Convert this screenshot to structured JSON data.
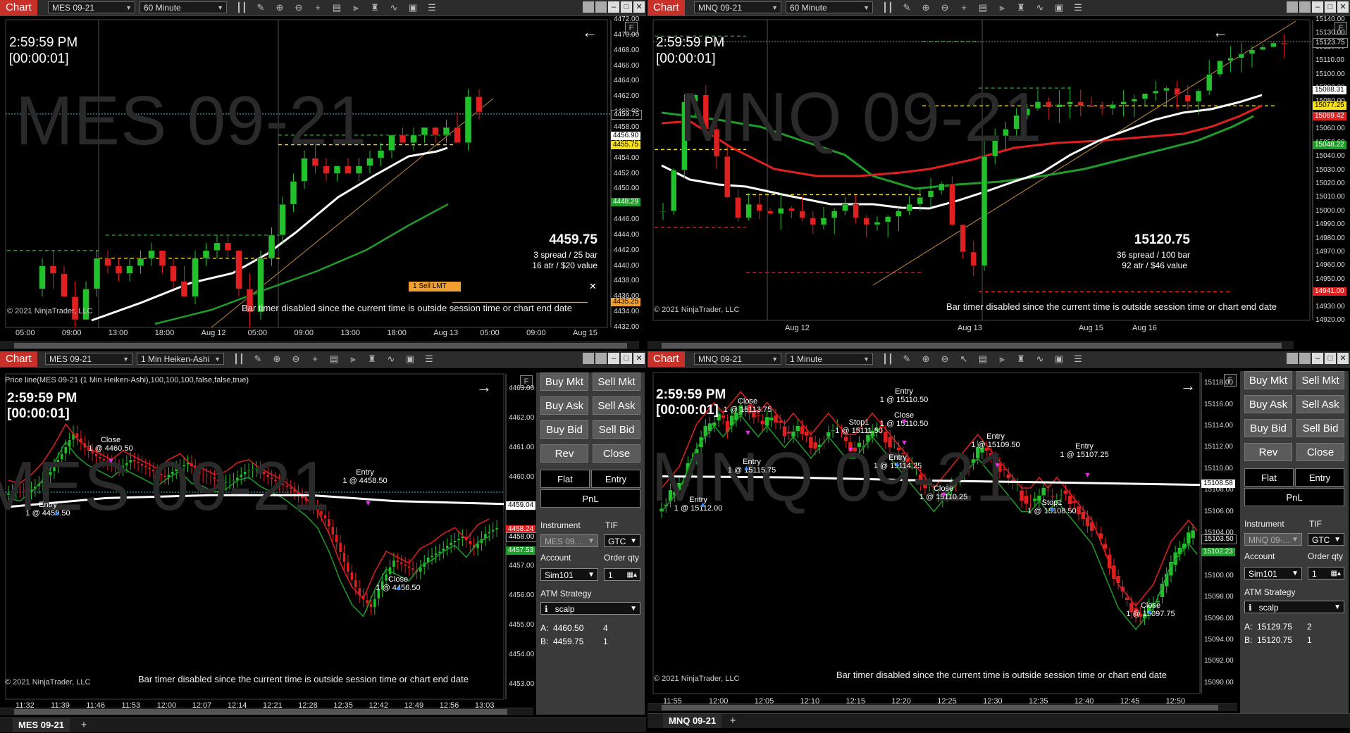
{
  "panels": {
    "p1": {
      "title": "Chart",
      "instrument": "MES 09-21",
      "interval": "60 Minute",
      "clock": "2:59:59 PM",
      "countdown": "[00:00:01]",
      "watermark": "MES 09-21",
      "big_price": "4459.75",
      "info1": "3 spread / 25 bar",
      "info2": "16 atr / $20 value",
      "copyright": "© 2021 NinjaTrader, LLC",
      "bar_timer": "Bar timer disabled since the current time is outside session time or chart end date",
      "order_label": "1 Sell LMT",
      "order_close": "✕",
      "y_ticks": [
        "4472.00",
        "4470.00",
        "4468.00",
        "4466.00",
        "4464.00",
        "4462.00",
        "4460.00",
        "4458.00",
        "4456.00",
        "4454.00",
        "4452.00",
        "4450.00",
        "4448.00",
        "4446.00",
        "4444.00",
        "4442.00",
        "4440.00",
        "4438.00",
        "4436.00",
        "4434.00",
        "4432.00"
      ],
      "x_ticks": [
        "05:00",
        "09:00",
        "13:00",
        "18:00",
        "Aug 12",
        "05:00",
        "09:00",
        "13:00",
        "18:00",
        "Aug 13",
        "05:00",
        "09:00",
        "Aug 15"
      ],
      "price_tags": [
        {
          "text": "4459.75",
          "color": "#000000",
          "text_color": "#ffffff"
        },
        {
          "text": "4456.90",
          "color": "#ffffff",
          "text_color": "#000000"
        },
        {
          "text": "4455.75",
          "color": "#f5e020",
          "text_color": "#000000"
        },
        {
          "text": "4448.29",
          "color": "#1f9c2a",
          "text_color": "#ffffff"
        },
        {
          "text": "4435.25",
          "color": "#f0a030",
          "text_color": "#000000"
        }
      ]
    },
    "p2": {
      "title": "Chart",
      "instrument": "MNQ 09-21",
      "interval": "60 Minute",
      "clock": "2:59:59 PM",
      "countdown": "[00:00:01]",
      "watermark": "MNQ 09-21",
      "big_price": "15120.75",
      "info1": "36 spread / 100 bar",
      "info2": "92 atr / $46 value",
      "copyright": "© 2021 NinjaTrader, LLC",
      "bar_timer": "Bar timer disabled since the current time is outside session time or chart end date",
      "y_ticks": [
        "15140.00",
        "15130.00",
        "15120.00",
        "15110.00",
        "15100.00",
        "15090.00",
        "15080.00",
        "15070.00",
        "15060.00",
        "15050.00",
        "15040.00",
        "15030.00",
        "15020.00",
        "15010.00",
        "15000.00",
        "14990.00",
        "14980.00",
        "14970.00",
        "14960.00",
        "14950.00",
        "14940.00",
        "14930.00",
        "14920.00"
      ],
      "x_ticks": [
        "Aug 12",
        "Aug 13",
        "Aug 15",
        "Aug 16"
      ],
      "price_tags": [
        {
          "text": "15123.75",
          "color": "#000000",
          "text_color": "#ffffff"
        },
        {
          "text": "15088.31",
          "color": "#ffffff",
          "text_color": "#000000"
        },
        {
          "text": "15077.25",
          "color": "#f5e020",
          "text_color": "#000000"
        },
        {
          "text": "15069.42",
          "color": "#e02020",
          "text_color": "#ffffff"
        },
        {
          "text": "15048.22",
          "color": "#1f9c2a",
          "text_color": "#ffffff"
        },
        {
          "text": "14941.00",
          "color": "#e02020",
          "text_color": "#ffffff"
        }
      ]
    },
    "p3": {
      "title": "Chart",
      "instrument": "MES 09-21",
      "interval": "1 Min Heiken-Ashi",
      "indicator": "Price line(MES 09-21 (1 Min Heiken-Ashi),100,100,100,false,false,true)",
      "clock": "2:59:59 PM",
      "countdown": "[00:00:01]",
      "watermark": "MES 09-21",
      "copyright": "© 2021 NinjaTrader, LLC",
      "bar_timer": "Bar timer disabled since the current time is outside session time or chart end date",
      "y_ticks": [
        "4463.00",
        "4462.00",
        "4461.00",
        "4460.00",
        "4459.00",
        "4458.00",
        "4457.00",
        "4456.00",
        "4455.00",
        "4454.00",
        "4453.00"
      ],
      "x_ticks": [
        "11:32",
        "11:39",
        "11:46",
        "11:53",
        "12:00",
        "12:07",
        "12:14",
        "12:21",
        "12:28",
        "12:35",
        "12:42",
        "12:49",
        "12:56",
        "13:03"
      ],
      "price_tags": [
        {
          "text": "4459.04",
          "color": "#ffffff",
          "text_color": "#000000"
        },
        {
          "text": "4458.24",
          "color": "#e02020",
          "text_color": "#ffffff"
        },
        {
          "text": "4458.00",
          "color": "#000000",
          "text_color": "#ffffff"
        },
        {
          "text": "4457.53",
          "color": "#1f9c2a",
          "text_color": "#ffffff"
        }
      ],
      "annotations": [
        {
          "l1": "Close",
          "l2": "1 @ 4460.50"
        },
        {
          "l1": "Entry",
          "l2": "1 @ 4459.50"
        },
        {
          "l1": "Entry",
          "l2": "1 @ 4458.50"
        },
        {
          "l1": "Close",
          "l2": "1 @ 4456.50"
        }
      ],
      "tab": "MES 09-21",
      "tab_plus": "+"
    },
    "p4": {
      "title": "Chart",
      "instrument": "MNQ 09-21",
      "interval": "1 Minute",
      "clock": "2:59:59 PM",
      "countdown": "[00:00:01]",
      "watermark": "MNQ 09-21",
      "copyright": "© 2021 NinjaTrader, LLC",
      "bar_timer": "Bar timer disabled since the current time is outside session time or chart end date",
      "y_ticks": [
        "15118.00",
        "15116.00",
        "15114.00",
        "15112.00",
        "15110.00",
        "15108.00",
        "15106.00",
        "15104.00",
        "15102.00",
        "15100.00",
        "15098.00",
        "15096.00",
        "15094.00",
        "15092.00",
        "15090.00"
      ],
      "x_ticks": [
        "11:55",
        "12:00",
        "12:05",
        "12:10",
        "12:15",
        "12:20",
        "12:25",
        "12:30",
        "12:35",
        "12:40",
        "12:45",
        "12:50"
      ],
      "price_tags": [
        {
          "text": "15108.58",
          "color": "#ffffff",
          "text_color": "#000000"
        },
        {
          "text": "15103.50",
          "color": "#000000",
          "text_color": "#ffffff"
        },
        {
          "text": "15102.23",
          "color": "#1f9c2a",
          "text_color": "#ffffff"
        }
      ],
      "annotations": [
        {
          "l1": "Close",
          "l2": "1 @ 15113.75"
        },
        {
          "l1": "Entry",
          "l2": "1 @ 15115.75"
        },
        {
          "l1": "Entry",
          "l2": "1 @ 15112.00"
        },
        {
          "l1": "Stop1",
          "l2": "1 @ 15111.50"
        },
        {
          "l1": "Entry",
          "l2": "1 @ 15110.50"
        },
        {
          "l1": "Close",
          "l2": "1 @ 15110.50"
        },
        {
          "l1": "Entry",
          "l2": "1 @ 15114.25"
        },
        {
          "l1": "Close",
          "l2": "1 @ 15110.25"
        },
        {
          "l1": "Entry",
          "l2": "1 @ 15109.50"
        },
        {
          "l1": "Stop1",
          "l2": "1 @ 15108.50"
        },
        {
          "l1": "Entry",
          "l2": "1 @ 15107.25"
        },
        {
          "l1": "Close",
          "l2": "1 @ 15097.75"
        }
      ],
      "tab": "MNQ 09-21",
      "tab_plus": "+"
    }
  },
  "order_entry": {
    "buttons": {
      "buy_mkt": "Buy Mkt",
      "sell_mkt": "Sell Mkt",
      "buy_ask": "Buy Ask",
      "sell_ask": "Sell Ask",
      "buy_bid": "Buy Bid",
      "sell_bid": "Sell Bid",
      "rev": "Rev",
      "close": "Close",
      "flat": "Flat",
      "entry": "Entry",
      "pnl": "PnL"
    },
    "labels": {
      "instrument": "Instrument",
      "tif": "TIF",
      "account": "Account",
      "order_qty": "Order qty",
      "atm": "ATM Strategy"
    },
    "left": {
      "instrument": "MES 09...",
      "tif": "GTC",
      "account": "Sim101",
      "qty": "1",
      "atm": "scalp",
      "ask_label": "A:",
      "ask_price": "4460.50",
      "ask_qty": "4",
      "bid_label": "B:",
      "bid_price": "4459.75",
      "bid_qty": "1"
    },
    "right": {
      "instrument": "MNQ 09-...",
      "tif": "GTC",
      "account": "Sim101",
      "qty": "1",
      "atm": "scalp",
      "ask_label": "A:",
      "ask_price": "15129.75",
      "ask_qty": "2",
      "bid_label": "B:",
      "bid_price": "15120.75",
      "bid_qty": "1"
    }
  },
  "icons": {
    "toolbar": [
      "bar-type-icon",
      "draw-icon",
      "zoom-in-icon",
      "zoom-out-icon",
      "crosshair-icon",
      "properties-icon",
      "indicators-icon",
      "strategies-icon",
      "drawing-tools-icon",
      "data-box-icon",
      "menu-icon"
    ]
  },
  "colors": {
    "up": "#22c02a",
    "down": "#e02020",
    "title_red": "#c8302a",
    "ema_white": "#ffffff",
    "sma_green": "#1f9c2a",
    "sma_red": "#e02020"
  }
}
